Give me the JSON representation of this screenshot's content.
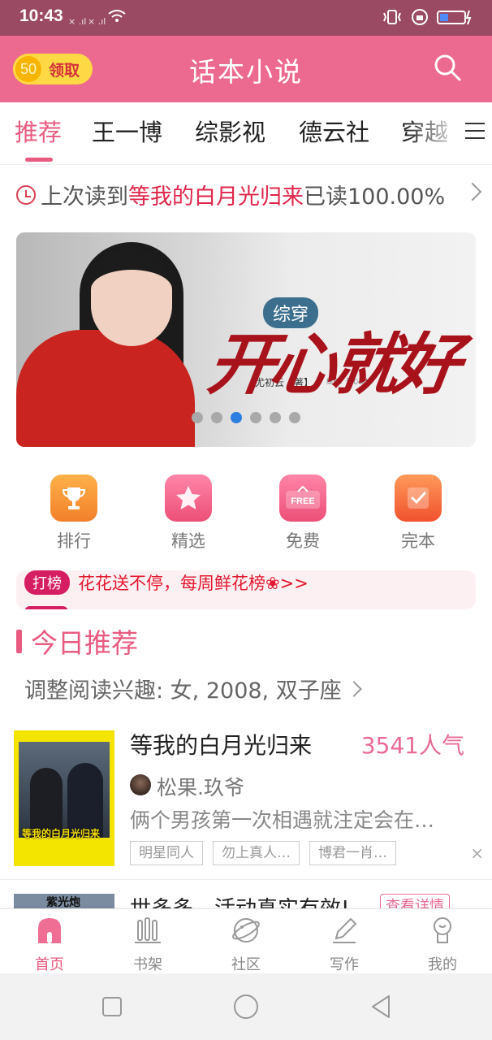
{
  "status_bar": {
    "time": "10:43",
    "signal1": "× .ıl",
    "signal2": "× .ıl"
  },
  "header": {
    "coin_count": "50",
    "coin_action": "领取",
    "title": "话本小说"
  },
  "tabs": [
    {
      "label": "推荐",
      "active": true
    },
    {
      "label": "王一博"
    },
    {
      "label": "综影视"
    },
    {
      "label": "德云社"
    },
    {
      "label": "穿越"
    }
  ],
  "last_read": {
    "prefix": "上次读到",
    "book": "等我的白月光归来",
    "suffix": "已读100.00%"
  },
  "banner": {
    "tag": "综穿",
    "title": "开心就好",
    "author": "尤初云【著】",
    "small_text": "综穿：开心就好",
    "dots": 6,
    "active_dot": 2
  },
  "quick_entries": [
    {
      "label": "排行",
      "icon": "trophy-icon",
      "color": "#f5963a"
    },
    {
      "label": "精选",
      "icon": "star-icon",
      "color": "#f06088"
    },
    {
      "label": "免费",
      "icon": "free-tag-icon",
      "color": "#f06088"
    },
    {
      "label": "完本",
      "icon": "check-book-icon",
      "color": "#f4683a"
    }
  ],
  "flower_strip": {
    "badge": "打榜",
    "text": "花花送不停，每周鲜花榜❀>>"
  },
  "today": {
    "section_title": "今日推荐",
    "interest": "调整阅读兴趣: 女, 2008, 双子座"
  },
  "book": {
    "cover_text": "等我的白月光归来",
    "title": "等我的白月光归来",
    "popularity": "3541人气",
    "author": "松果.玖爷",
    "description": "俩个男孩第一次相遇就注定会在…",
    "tags": [
      "明星同人",
      "勿上真人…",
      "博君一肖…"
    ],
    "close": "×"
  },
  "peek": {
    "cover_text": "紫光炮",
    "title": "世多多，活动真实有效!",
    "button": "查看详情"
  },
  "bottom_nav": [
    {
      "label": "首页",
      "icon": "home-icon",
      "active": true
    },
    {
      "label": "书架",
      "icon": "bookshelf-icon"
    },
    {
      "label": "社区",
      "icon": "community-icon"
    },
    {
      "label": "写作",
      "icon": "pen-icon"
    },
    {
      "label": "我的",
      "icon": "profile-icon"
    }
  ],
  "colors": {
    "brand": "#ec6a8f",
    "accent": "#e85a80",
    "highlight": "#e0254a"
  }
}
